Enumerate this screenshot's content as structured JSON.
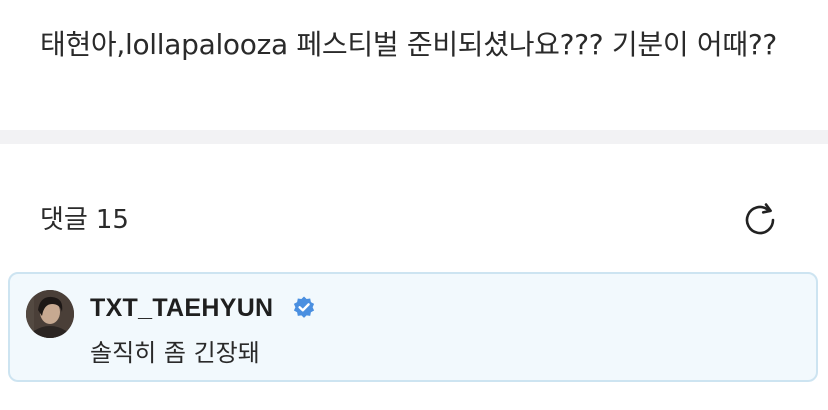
{
  "post": {
    "text": "태현아,lollapalooza 페스티벌 준비되셨나요??? 기분이 어때??"
  },
  "comments": {
    "label": "댓글",
    "count": "15",
    "refresh_icon": "refresh-icon"
  },
  "highlighted_comment": {
    "author": "TXT_TAEHYUN",
    "verified": true,
    "verified_icon": "verified-badge-icon",
    "text": "솔직히 좀 긴장돼",
    "colors": {
      "card_background": "#f2f9fd",
      "card_border": "#cde4f1",
      "badge": "#4a8fe0"
    }
  }
}
